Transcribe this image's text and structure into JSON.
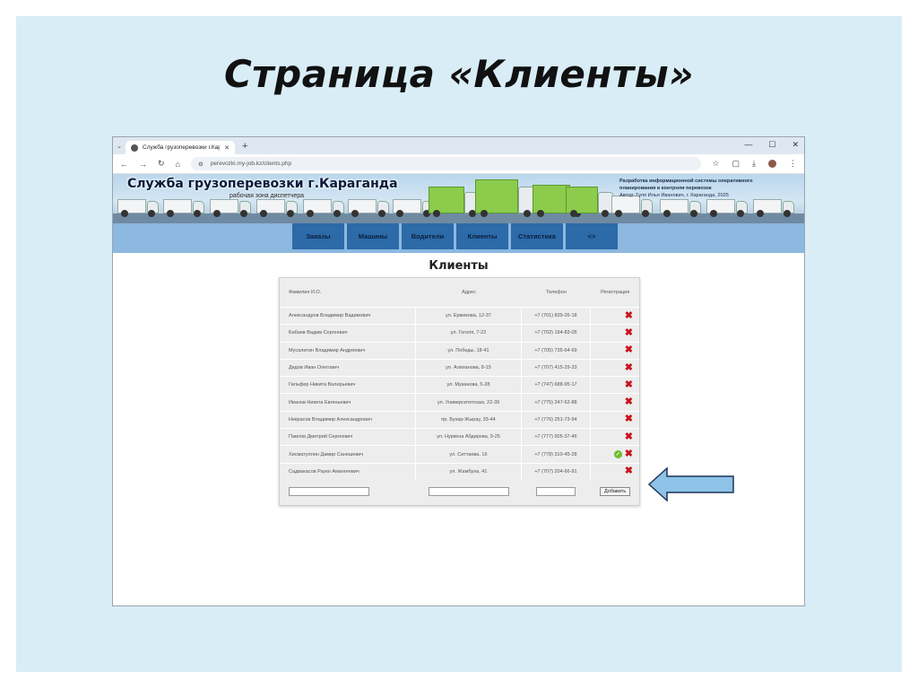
{
  "slide": {
    "title": "Страница «Клиенты»"
  },
  "browser": {
    "tab_title": "Служба грузоперевозки г.Кар",
    "url": "perevozki.my-job.kz/clients.php"
  },
  "site": {
    "title": "Служба грузоперевозки г.Караганда",
    "subtitle": "рабочая зона диспетчера",
    "info_line1": "Разработка информационной системы оперативного",
    "info_line2": "планирования и контроля перевозок",
    "info_author": "Автор: Гуля Илья Иванович, г. Караганда, 2025"
  },
  "nav": {
    "items": [
      "Заказы",
      "Машины",
      "Водители",
      "Клиенты",
      "Статистика",
      "<>"
    ]
  },
  "page": {
    "heading": "Клиенты"
  },
  "table": {
    "headers": [
      "Фамилия И.О.",
      "Адрес",
      "Телефон",
      "Регистрация"
    ],
    "rows": [
      {
        "name": "Александров Владимир Вадимович",
        "address": "ул. Ермекова, 12-37",
        "phone": "+7 (701) 839-26-18"
      },
      {
        "name": "Бабаев Вадим Сергеевич",
        "address": "ул. Гоголя, 7-22",
        "phone": "+7 (702) 194-83-05"
      },
      {
        "name": "Мусалитин Владимир Андреевич",
        "address": "ул. Победы, 18-41",
        "phone": "+7 (705) 735-64-69"
      },
      {
        "name": "Дедов Иван Олегович",
        "address": "ул. Алиханова, 8-15",
        "phone": "+7 (707) 415-29-33"
      },
      {
        "name": "Гильфер Никита Валерьевич",
        "address": "ул. Муканова, 5-28",
        "phone": "+7 (747) 688-95-17"
      },
      {
        "name": "Иванов Никита Евгеньевич",
        "address": "ул. Университетская, 22-39",
        "phone": "+7 (775) 347-62-88"
      },
      {
        "name": "Некрасов Владимир Александрович",
        "address": "пр. Бухар-Жырау, 33-44",
        "phone": "+7 (776) 251-73-94"
      },
      {
        "name": "Павлов Дмитрий Сергеевич",
        "address": "ул. Нуркена Абдирова, 9-25",
        "phone": "+7 (777) 905-37-46"
      },
      {
        "name": "Хисматуллин Дамир Санешевич",
        "address": "ул. Ситтаева, 16",
        "phone": "+7 (778) 310-45-28",
        "registered": true
      },
      {
        "name": "Садвакасов Раукн Амангеевич",
        "address": "ул. Жамбула, 41",
        "phone": "+7 (707) 204-66-91"
      }
    ],
    "add_button": "Добавить"
  },
  "colors": {
    "slide_bg": "#d9edf7",
    "nav_bg": "#8db8df",
    "nav_item": "#2c6aa8",
    "delete": "#c8141b",
    "registered": "#6cbf2f",
    "arrow_fill": "#8ec3e8"
  }
}
